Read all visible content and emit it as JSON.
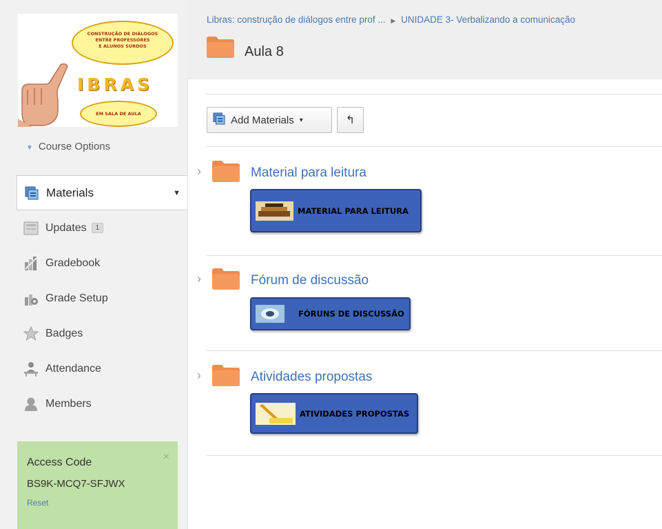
{
  "logo": {
    "bubble_top_lines": [
      "CONSTRUÇÃO DE DIÁLOGOS",
      "ENTRE PROFESSORES",
      "E ALUNOS SURDOS"
    ],
    "word": "IBRAS",
    "bubble_bottom": "EM SALA DE AULA"
  },
  "sidebar": {
    "course_options": "Course Options",
    "items": [
      {
        "label": "Materials",
        "icon": "materials-icon",
        "active": true
      },
      {
        "label": "Updates",
        "icon": "updates-icon",
        "badge": "1"
      },
      {
        "label": "Gradebook",
        "icon": "gradebook-icon"
      },
      {
        "label": "Grade Setup",
        "icon": "grade-setup-icon"
      },
      {
        "label": "Badges",
        "icon": "badges-icon"
      },
      {
        "label": "Attendance",
        "icon": "attendance-icon"
      },
      {
        "label": "Members",
        "icon": "members-icon"
      }
    ],
    "access": {
      "title": "Access Code",
      "code": "BS9K-MCQ7-SFJWX",
      "reset": "Reset",
      "close": "×"
    }
  },
  "header": {
    "breadcrumb": [
      "Libras: construção de diálogos entre prof ...",
      "UNIDADE 3- Verbalizando a comunicação"
    ],
    "separator": "▶",
    "title": "Aula 8"
  },
  "toolbar": {
    "add_label": "Add Materials",
    "add_caret": "▾",
    "undo_symbol": "↰"
  },
  "materials": [
    {
      "title": "Material para leitura",
      "banner": "MATERIAL PARA LEITURA"
    },
    {
      "title": "Fórum de discussão",
      "banner": "FÓRUNS DE DISCUSSÃO"
    },
    {
      "title": "Atividades propostas",
      "banner": "ATIVIDADES PROPOSTAS"
    }
  ],
  "colors": {
    "link": "#3b72b8",
    "folder": "#f2884f",
    "banner": "#3d63b8",
    "access_bg": "#bfe0a6"
  }
}
